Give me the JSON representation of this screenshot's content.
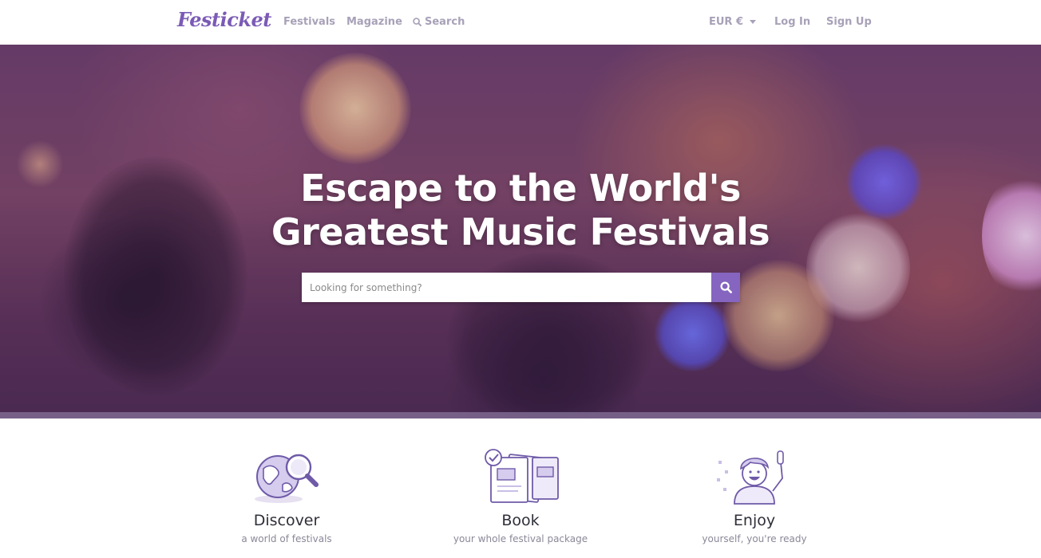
{
  "header": {
    "logo": "Festicket",
    "nav": {
      "festivals": "Festivals",
      "magazine": "Magazine",
      "search": "Search"
    },
    "currency": "EUR €",
    "login": "Log In",
    "signup": "Sign Up"
  },
  "hero": {
    "title_line1": "Escape to the World's",
    "title_line2": "Greatest Music Festivals",
    "search_placeholder": "Looking for something?"
  },
  "features": [
    {
      "title": "Discover",
      "subtitle": "a world of festivals",
      "icon": "globe-magnifier-icon"
    },
    {
      "title": "Book",
      "subtitle": "your whole festival package",
      "icon": "booklet-checkmark-icon"
    },
    {
      "title": "Enjoy",
      "subtitle": "yourself, you're ready",
      "icon": "happy-person-icon"
    }
  ],
  "colors": {
    "brand": "#7b5bb6",
    "search_button": "#8565bf",
    "nav_text": "#a8a1b8"
  }
}
